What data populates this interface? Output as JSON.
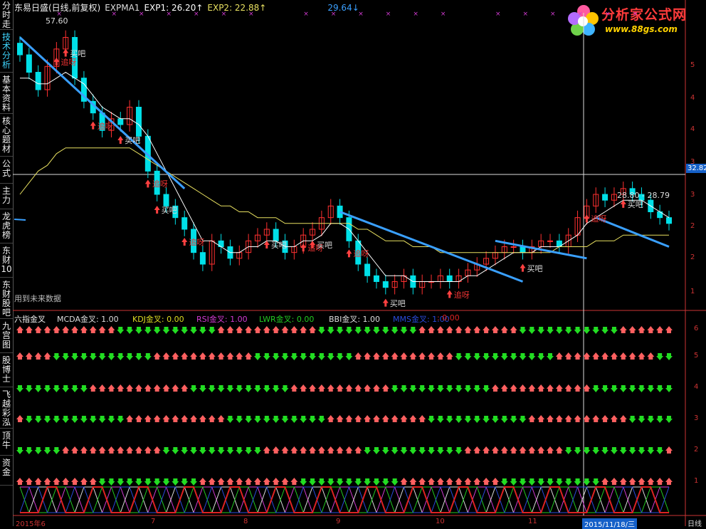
{
  "sidebar": {
    "tabs": [
      {
        "label": "分时走势",
        "active": false
      },
      {
        "label": "技术分析",
        "active": true
      },
      {
        "label": "基本资料",
        "active": false
      },
      {
        "label": "核心题材",
        "active": false
      },
      {
        "label": "公式",
        "active": false
      },
      {
        "label": "主力",
        "active": false
      },
      {
        "label": "龙虎榜",
        "active": false
      },
      {
        "label": "东财10",
        "active": false
      },
      {
        "label": "东财股吧",
        "active": false
      },
      {
        "label": "九宫图",
        "active": false
      },
      {
        "label": "股博士",
        "active": false
      },
      {
        "label": "飞越彩泓",
        "active": false
      },
      {
        "label": "顶牛",
        "active": false
      },
      {
        "label": "资金",
        "active": false
      }
    ]
  },
  "header": {
    "stock_title": "东易日盛(日线,前复权)",
    "indicator": "EXPMA1",
    "exp1": "EXP1: 26.20↑",
    "exp2": "EXP2: 22.88↑",
    "extra": "29.64↓"
  },
  "logo": {
    "name": "分析家公式网",
    "url": "www.88gs.com"
  },
  "price_axis": {
    "labels": [
      "5",
      "4",
      "4",
      "3",
      "3",
      "2",
      "2",
      "1"
    ],
    "crosshair_value": "32.82"
  },
  "chart_annotations": {
    "high": "57.60",
    "range_note": "28.80 - 28.79",
    "future_note": "用到未来数据",
    "signal_sell": "追呀",
    "signal_buy": "买吧"
  },
  "indicator_panel": {
    "title": "六指金叉",
    "items": [
      {
        "label": "MCDA金叉: 1.00",
        "color": "#dddddd"
      },
      {
        "label": "KDJ金叉: 0.00",
        "color": "#dddd22"
      },
      {
        "label": "RSI金叉: 1.00",
        "color": "#d23bd2"
      },
      {
        "label": "LWR金叉: 0.00",
        "color": "#22cc22"
      },
      {
        "label": "BBI金叉: 1.00",
        "color": "#dddddd"
      },
      {
        "label": "MMS金叉: 1.00",
        "color": "#2a4bdd"
      },
      {
        "label": ": 0.00",
        "color": "#dd2222"
      }
    ],
    "row_values": [
      "6",
      "5",
      "4",
      "3",
      "2",
      "1"
    ]
  },
  "date_axis": {
    "labels": [
      "2015年6",
      "7",
      "8",
      "9",
      "10",
      "11"
    ],
    "crosshair_date": "2015/11/18/三",
    "right_tab": "日线"
  },
  "colors": {
    "up": "#ff3030",
    "down": "#00e0e8",
    "trend": "#3aa0ff",
    "ma_short": "#ffffff",
    "ma_long": "#e8e060",
    "signal_green": "#22dd22",
    "signal_red": "#ff6060"
  },
  "chart_data": [
    {
      "type": "candlestick",
      "title": "东易日盛(日线,前复权)",
      "x": [
        "2015-06",
        "2015-06",
        "2015-06",
        "2015-06",
        "2015-06",
        "2015-06",
        "2015-06",
        "2015-06",
        "2015-06",
        "2015-06",
        "2015-06",
        "2015-06",
        "2015-07",
        "2015-07",
        "2015-07",
        "2015-07",
        "2015-07",
        "2015-07",
        "2015-07",
        "2015-07",
        "2015-07",
        "2015-07",
        "2015-07",
        "2015-07",
        "2015-08",
        "2015-08",
        "2015-08",
        "2015-08",
        "2015-08",
        "2015-08",
        "2015-08",
        "2015-08",
        "2015-08",
        "2015-08",
        "2015-08",
        "2015-08",
        "2015-09",
        "2015-09",
        "2015-09",
        "2015-09",
        "2015-09",
        "2015-09",
        "2015-09",
        "2015-09",
        "2015-09",
        "2015-09",
        "2015-09",
        "2015-09",
        "2015-10",
        "2015-10",
        "2015-10",
        "2015-10",
        "2015-10",
        "2015-10",
        "2015-10",
        "2015-10",
        "2015-10",
        "2015-10",
        "2015-10",
        "2015-10",
        "2015-11",
        "2015-11",
        "2015-11",
        "2015-11",
        "2015-11",
        "2015-11",
        "2015-11",
        "2015-11",
        "2015-11",
        "2015-11",
        "2015-11",
        "2015-11"
      ],
      "close": [
        54,
        51,
        48,
        52,
        55,
        57,
        50,
        46,
        44,
        41,
        43,
        42,
        45,
        40,
        34,
        30,
        28,
        26,
        24,
        20,
        18,
        22,
        21,
        19,
        20,
        22,
        23,
        24,
        22,
        20,
        21,
        23,
        24,
        26,
        28,
        26,
        22,
        18,
        16,
        15,
        14,
        15,
        16,
        14,
        15,
        15,
        16,
        15,
        16,
        17,
        18,
        19,
        20,
        21,
        21,
        20,
        21,
        22,
        22,
        21,
        23,
        26,
        28,
        30,
        29,
        30,
        31,
        30,
        29,
        27,
        26,
        25
      ],
      "ylim": [
        12,
        60
      ],
      "series_ema": [
        {
          "name": "EXP1",
          "values": [
            50,
            50,
            49,
            49,
            50,
            51,
            50,
            49,
            47,
            45,
            44,
            43,
            43,
            42,
            40,
            37,
            34,
            31,
            28,
            25,
            22,
            22,
            21,
            20,
            20,
            21,
            21,
            22,
            22,
            21,
            21,
            22,
            22,
            23,
            25,
            25,
            24,
            22,
            20,
            18,
            16,
            16,
            16,
            15,
            15,
            15,
            15,
            15,
            15,
            16,
            16,
            17,
            18,
            19,
            20,
            20,
            20,
            21,
            21,
            21,
            22,
            23,
            25,
            26,
            27,
            28,
            29,
            29,
            29,
            28,
            27,
            26
          ]
        },
        {
          "name": "EXP2",
          "values": [
            30,
            32,
            34,
            35,
            37,
            38,
            38,
            38,
            38,
            38,
            38,
            38,
            38,
            37,
            36,
            35,
            34,
            33,
            32,
            31,
            30,
            29,
            28,
            28,
            27,
            27,
            26,
            26,
            26,
            25,
            25,
            25,
            25,
            25,
            25,
            25,
            25,
            24,
            24,
            23,
            22,
            22,
            22,
            21,
            21,
            21,
            20,
            20,
            20,
            20,
            20,
            20,
            20,
            20,
            20,
            20,
            20,
            20,
            20,
            21,
            21,
            21,
            21,
            22,
            22,
            22,
            23,
            23,
            23,
            23,
            23,
            23
          ]
        }
      ]
    },
    {
      "type": "signal_rows",
      "title": "六指金叉",
      "series": [
        {
          "name": "MCDA金叉",
          "value": 1.0
        },
        {
          "name": "KDJ金叉",
          "value": 0.0
        },
        {
          "name": "RSI金叉",
          "value": 1.0
        },
        {
          "name": "LWR金叉",
          "value": 0.0
        },
        {
          "name": "BBI金叉",
          "value": 1.0
        },
        {
          "name": "MMS金叉",
          "value": 1.0
        }
      ]
    }
  ]
}
